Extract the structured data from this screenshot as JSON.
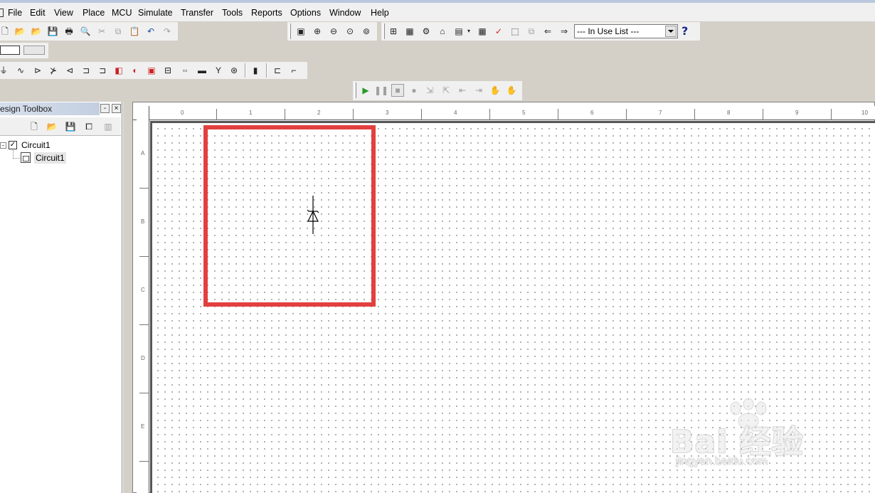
{
  "menu": {
    "items": [
      "File",
      "Edit",
      "View",
      "Place",
      "MCU",
      "Simulate",
      "Transfer",
      "Tools",
      "Reports",
      "Options",
      "Window",
      "Help"
    ]
  },
  "toolbar": {
    "in_use_list": "--- In Use List ---",
    "help_glyph": "?"
  },
  "toolbox": {
    "title": "esign Toolbox",
    "minimize_glyph": "-",
    "close_glyph": "×",
    "tree": {
      "root_label": "Circuit1",
      "child_label": "Circuit1"
    }
  },
  "ruler": {
    "columns": [
      "0",
      "1",
      "2",
      "3",
      "4",
      "5",
      "6",
      "7",
      "8",
      "9",
      "10"
    ],
    "rows": [
      "A",
      "B",
      "C",
      "D",
      "E"
    ]
  },
  "watermark": {
    "main": "Bai 经验",
    "sub": "jingyan.baidu.com"
  },
  "colors": {
    "highlight": "#e2403f",
    "title_bar": "#c3cfe0"
  }
}
